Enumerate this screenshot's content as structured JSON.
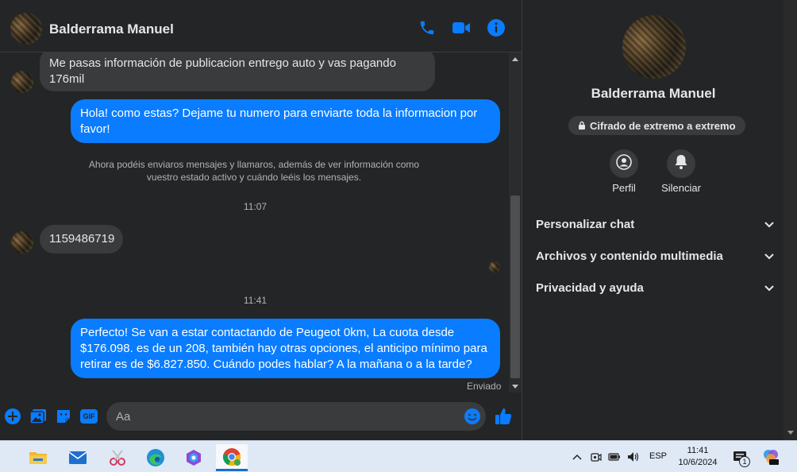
{
  "contact": {
    "name": "Balderrama Manuel"
  },
  "header": {
    "call_icon": "phone-icon",
    "video_icon": "video-icon",
    "info_icon": "info-icon"
  },
  "messages": {
    "m1": "Me pasas información de publicacion entrego auto y vas pagando 176mil",
    "m2": "Hola! como estas? Dejame tu numero para enviarte toda la informacion por favor!",
    "notice": "Ahora podéis enviaros mensajes y llamaros, además de ver información como vuestro estado activo y cuándo leéis los mensajes.",
    "time1": "11:07",
    "m3": "1159486719",
    "time2": "11:41",
    "m4": "Perfecto!  Se van a estar contactando de Peugeot 0km, La cuota desde $176.098. es de un 208, también hay otras opciones, el anticipo mínimo para retirar es de $6.827.850. Cuándo podes hablar? A la mañana o a la tarde?",
    "status": "Enviado"
  },
  "composer": {
    "placeholder": "Aa",
    "icons": [
      "plus-icon",
      "image-icon",
      "sticker-icon",
      "gif-icon",
      "emoji-icon",
      "thumbs-up-icon"
    ],
    "gif_label": "GIF"
  },
  "details": {
    "name": "Balderrama Manuel",
    "e2e": "Cifrado de extremo a extremo",
    "actions": {
      "profile": "Perfil",
      "mute": "Silenciar"
    },
    "sections": [
      "Personalizar chat",
      "Archivos y contenido multimedia",
      "Privacidad y ayuda"
    ]
  },
  "taskbar": {
    "apps": [
      "file-explorer-icon",
      "mail-icon",
      "snipping-tool-icon",
      "edge-icon",
      "copilot-icon",
      "chrome-icon"
    ],
    "language": "ESP",
    "time": "11:41",
    "date": "10/6/2024",
    "notification_count": "1"
  },
  "colors": {
    "accent": "#0a7cff",
    "bg": "#242526",
    "bubble_in": "#3a3b3c"
  }
}
